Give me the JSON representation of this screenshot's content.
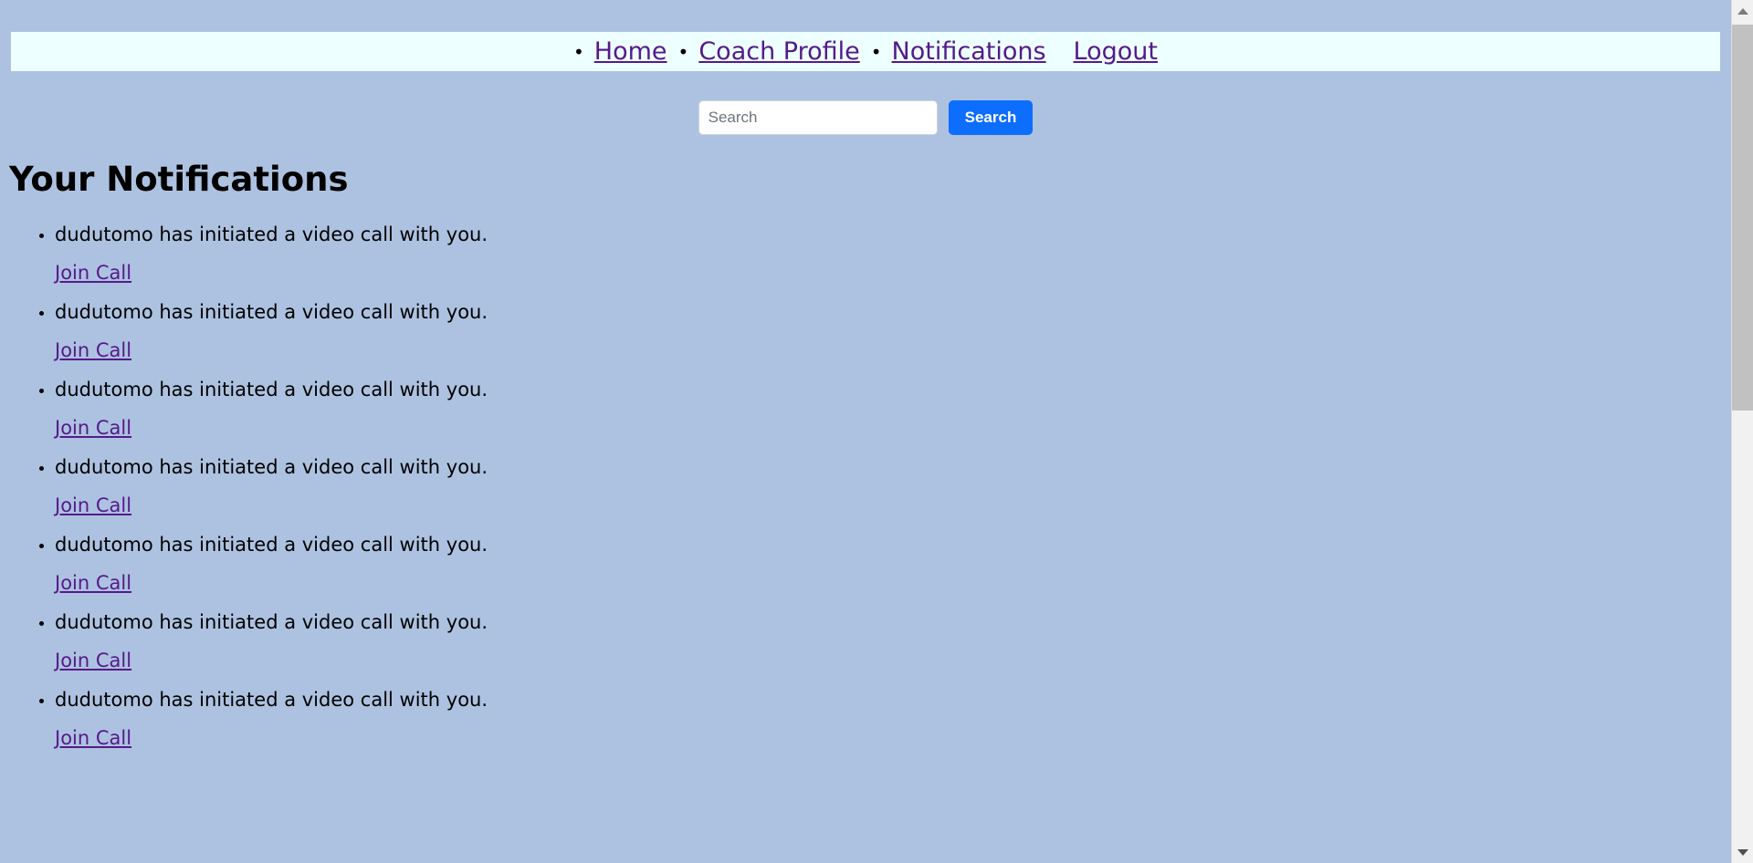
{
  "page": {
    "title": "Your Notifications",
    "background_color": "#adc2e0",
    "link_color": "#551a8b",
    "accent_color": "#0d6efd"
  },
  "nav": {
    "background_color": "#edffff",
    "items": [
      {
        "label": "Home",
        "bullet": "•",
        "has_bullet": true
      },
      {
        "label": "Coach Profile",
        "bullet": "•",
        "has_bullet": true
      },
      {
        "label": "Notifications",
        "bullet": "•",
        "has_bullet": true
      },
      {
        "label": "Logout",
        "bullet": "•",
        "has_bullet": false
      }
    ]
  },
  "search": {
    "placeholder": "Search",
    "value": "",
    "button_label": "Search"
  },
  "notifications": {
    "heading": "Your Notifications",
    "join_label": "Join Call",
    "items": [
      {
        "text": "dudutomo has initiated a video call with you.",
        "action": "Join Call"
      },
      {
        "text": "dudutomo has initiated a video call with you.",
        "action": "Join Call"
      },
      {
        "text": "dudutomo has initiated a video call with you.",
        "action": "Join Call"
      },
      {
        "text": "dudutomo has initiated a video call with you.",
        "action": "Join Call"
      },
      {
        "text": "dudutomo has initiated a video call with you.",
        "action": "Join Call"
      },
      {
        "text": "dudutomo has initiated a video call with you.",
        "action": "Join Call"
      },
      {
        "text": "dudutomo has initiated a video call with you.",
        "action": "Join Call"
      }
    ]
  },
  "scrollbar": {
    "up_icon": "scroll-up-arrow-icon",
    "down_icon": "scroll-down-arrow-icon",
    "thumb_position_percent": 0
  }
}
